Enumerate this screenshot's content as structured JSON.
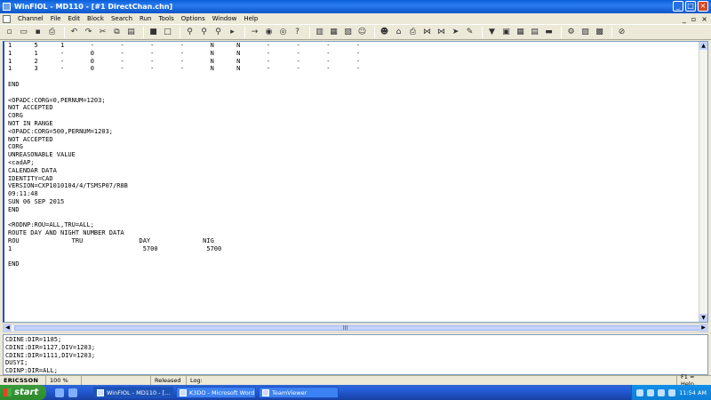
{
  "window": {
    "title": "WinFIOL - MD110 - [#1 DirectChan.chn]",
    "controls": [
      "_",
      "□",
      "×"
    ]
  },
  "menu": {
    "items": [
      "Channel",
      "File",
      "Edit",
      "Block",
      "Search",
      "Run",
      "Tools",
      "Options",
      "Window",
      "Help"
    ],
    "mdi_controls": [
      "_",
      "▫",
      "×"
    ]
  },
  "toolbar": {
    "icons": [
      "new-document-icon",
      "open-folder-icon",
      "save-icon",
      "print-icon",
      "undo-icon",
      "redo-icon",
      "cut-icon",
      "copy-icon",
      "paste-icon",
      "channel-blue-icon",
      "channel-gray-icon",
      "find-icon",
      "find-next-icon",
      "replace-icon",
      "run-icon",
      "arrow-right-icon",
      "connect-icon",
      "disconnect-icon",
      "help-icon",
      "split-icon",
      "window-icon",
      "tile-icon",
      "user-icon",
      "user-alt-icon",
      "lock-icon",
      "print-alt-icon",
      "network-icon",
      "network-alt-icon",
      "send-icon",
      "edit-icon",
      "filter-icon",
      "export-icon",
      "table-icon",
      "book-icon",
      "ruler-icon",
      "settings-icon",
      "chart-icon",
      "grid-icon",
      "disabled-icon"
    ]
  },
  "editor": {
    "lines": [
      "1      5      1       -       -       -       -       N      N       -       -       -       -",
      "1      1      -       0       -       -       -       N      N       -       -       -       -",
      "1      2      -       0       -       -       -       N      N       -       -       -       -",
      "1      3      -       0       -       -       -       N      N       -       -       -       -",
      "",
      "END",
      "",
      "<OPADC:CORG=0,PERNUM=1203;",
      "NOT ACCEPTED",
      "CORG",
      "NOT IN RANGE",
      "<OPADC:CORG=500,PERNUM=1203;",
      "NOT ACCEPTED",
      "CORG",
      "UNREASONABLE VALUE",
      "<cadAP;",
      "CALENDAR DATA",
      "IDENTITY=CAD",
      "VERSION=CXP1010104/4/TSMSP07/R8B",
      "09:11:48",
      "SUN 06 SEP 2015",
      "END",
      "",
      "<RODNP:ROU=ALL,TRU=ALL;",
      "ROUTE DAY AND NIGHT NUMBER DATA",
      "ROU              TRU               DAY              NIG",
      "1                                   5700             5700",
      "",
      "END"
    ]
  },
  "command_pane": {
    "lines": [
      "CDINE:DIR=1185;",
      "CDINI:DIR=1127,DIV=1203;",
      "CDINI:DIR=1111,DIV=1203;",
      "DUSYI;",
      "CDINP:DIR=ALL;"
    ]
  },
  "status": {
    "brand": "ERICSSON",
    "zoom": "100 %",
    "empty": "",
    "released": "Released",
    "log": "Log:",
    "help": "F1 = Help"
  },
  "taskbar": {
    "start": "start",
    "tasks": [
      "WinFIOL - MD110 - [...",
      "K3DO - Microsoft Word",
      "TeamViewer"
    ],
    "clock": "11:54 AM"
  }
}
